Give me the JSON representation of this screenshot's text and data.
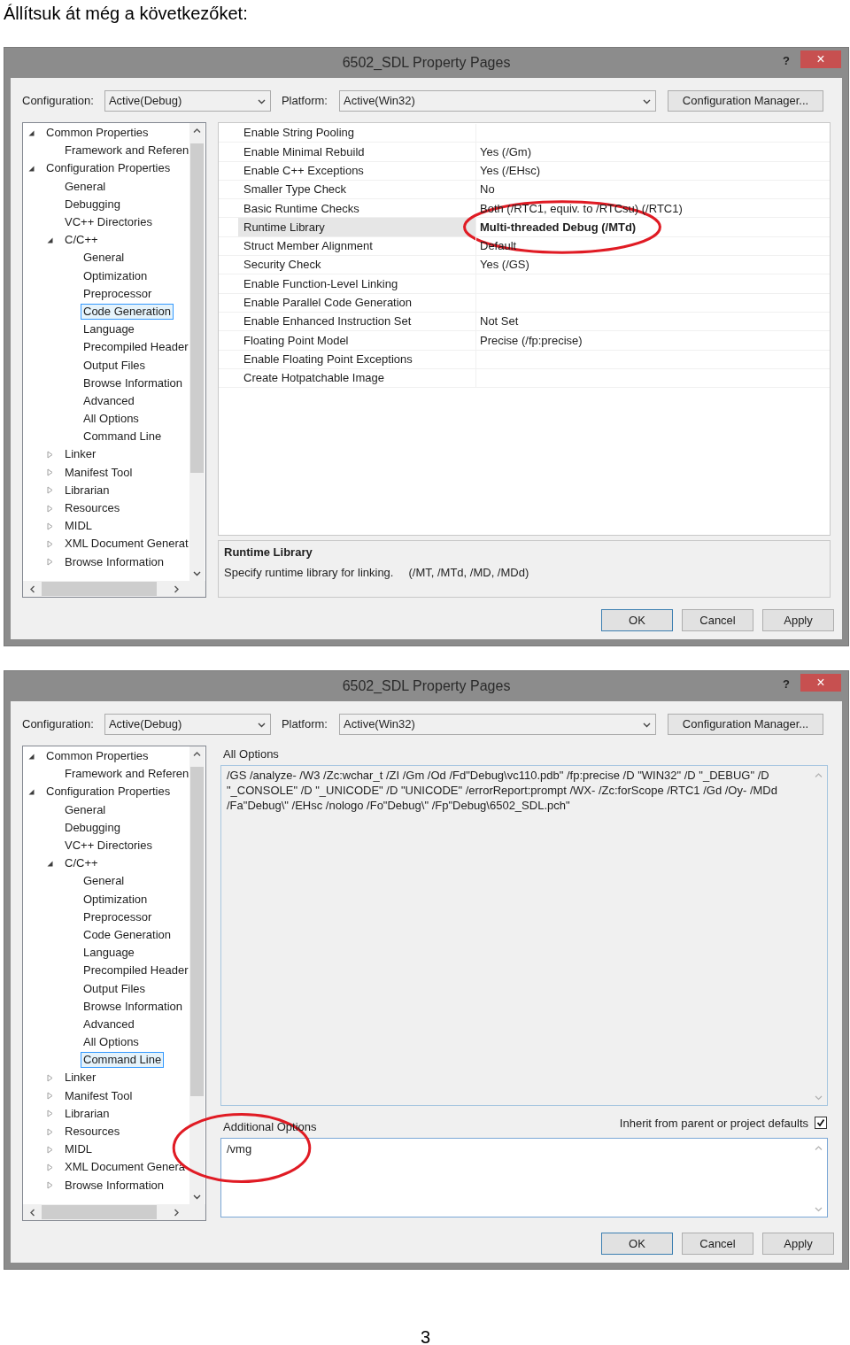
{
  "heading": "Állítsuk át még a következőket:",
  "dialogs": [
    {
      "title": "6502_SDL Property Pages",
      "help": "?",
      "close": "×",
      "configuration": {
        "label": "Configuration:",
        "value": "Active(Debug)"
      },
      "platform": {
        "label": "Platform:",
        "value": "Active(Win32)"
      },
      "manager_button": "Configuration Manager...",
      "tree": [
        {
          "label": "Common Properties",
          "expanded": true,
          "selected": false,
          "children": [
            {
              "label": "Framework and Referen",
              "selected": false
            }
          ]
        },
        {
          "label": "Configuration Properties",
          "expanded": true,
          "selected": false,
          "children": [
            {
              "label": "General",
              "selected": false
            },
            {
              "label": "Debugging",
              "selected": false
            },
            {
              "label": "VC++ Directories",
              "selected": false
            },
            {
              "label": "C/C++",
              "expanded": true,
              "selected": false,
              "children": [
                {
                  "label": "General",
                  "selected": false
                },
                {
                  "label": "Optimization",
                  "selected": false
                },
                {
                  "label": "Preprocessor",
                  "selected": false
                },
                {
                  "label": "Code Generation",
                  "selected": true
                },
                {
                  "label": "Language",
                  "selected": false
                },
                {
                  "label": "Precompiled Header",
                  "selected": false
                },
                {
                  "label": "Output Files",
                  "selected": false
                },
                {
                  "label": "Browse Information",
                  "selected": false
                },
                {
                  "label": "Advanced",
                  "selected": false
                },
                {
                  "label": "All Options",
                  "selected": false
                },
                {
                  "label": "Command Line",
                  "selected": false
                }
              ]
            },
            {
              "label": "Linker",
              "expanded": false,
              "selected": false
            },
            {
              "label": "Manifest Tool",
              "expanded": false,
              "selected": false
            },
            {
              "label": "Librarian",
              "expanded": false,
              "selected": false
            },
            {
              "label": "Resources",
              "expanded": false,
              "selected": false
            },
            {
              "label": "MIDL",
              "expanded": false,
              "selected": false
            },
            {
              "label": "XML Document Generat",
              "expanded": false,
              "selected": false
            },
            {
              "label": "Browse Information",
              "expanded": false,
              "selected": false
            }
          ]
        }
      ],
      "content": {
        "kind": "grid",
        "rows": [
          {
            "name": "Enable String Pooling",
            "selected": false
          },
          {
            "name": "Enable Minimal Rebuild",
            "value": "Yes (/Gm)",
            "selected": false,
            "bold": false
          },
          {
            "name": "Enable C++ Exceptions",
            "value": "Yes (/EHsc)",
            "selected": false,
            "bold": false
          },
          {
            "name": "Smaller Type Check",
            "value": "No",
            "selected": false,
            "bold": false
          },
          {
            "name": "Basic Runtime Checks",
            "value": "Both (/RTC1, equiv. to /RTCsu) (/RTC1)",
            "selected": false,
            "bold": false
          },
          {
            "name": "Runtime Library",
            "value": "Multi-threaded Debug (/MTd)",
            "selected": true,
            "bold": true,
            "circled": true
          },
          {
            "name": "Struct Member Alignment",
            "value": "Default",
            "selected": false,
            "bold": false
          },
          {
            "name": "Security Check",
            "value": "Yes (/GS)",
            "selected": false,
            "bold": false
          },
          {
            "name": "Enable Function-Level Linking",
            "selected": false
          },
          {
            "name": "Enable Parallel Code Generation",
            "selected": false
          },
          {
            "name": "Enable Enhanced Instruction Set",
            "value": "Not Set",
            "selected": false,
            "bold": false
          },
          {
            "name": "Floating Point Model",
            "value": "Precise (/fp:precise)",
            "selected": false,
            "bold": false
          },
          {
            "name": "Enable Floating Point Exceptions",
            "selected": false
          },
          {
            "name": "Create Hotpatchable Image",
            "selected": false
          }
        ],
        "description": {
          "title": "Runtime Library",
          "text": "Specify runtime library for linking.",
          "options": "(/MT, /MTd, /MD, /MDd)"
        }
      },
      "buttons": [
        {
          "label": "OK",
          "default": true
        },
        {
          "label": "Cancel",
          "default": false
        },
        {
          "label": "Apply",
          "default": false
        }
      ]
    },
    {
      "title": "6502_SDL Property Pages",
      "help": "?",
      "close": "×",
      "configuration": {
        "label": "Configuration:",
        "value": "Active(Debug)"
      },
      "platform": {
        "label": "Platform:",
        "value": "Active(Win32)"
      },
      "manager_button": "Configuration Manager...",
      "tree": [
        {
          "label": "Common Properties",
          "expanded": true,
          "selected": false,
          "children": [
            {
              "label": "Framework and Referen",
              "selected": false
            }
          ]
        },
        {
          "label": "Configuration Properties",
          "expanded": true,
          "selected": false,
          "children": [
            {
              "label": "General",
              "selected": false
            },
            {
              "label": "Debugging",
              "selected": false
            },
            {
              "label": "VC++ Directories",
              "selected": false
            },
            {
              "label": "C/C++",
              "expanded": true,
              "selected": false,
              "children": [
                {
                  "label": "General",
                  "selected": false
                },
                {
                  "label": "Optimization",
                  "selected": false
                },
                {
                  "label": "Preprocessor",
                  "selected": false
                },
                {
                  "label": "Code Generation",
                  "selected": false
                },
                {
                  "label": "Language",
                  "selected": false
                },
                {
                  "label": "Precompiled Header",
                  "selected": false
                },
                {
                  "label": "Output Files",
                  "selected": false
                },
                {
                  "label": "Browse Information",
                  "selected": false
                },
                {
                  "label": "Advanced",
                  "selected": false
                },
                {
                  "label": "All Options",
                  "selected": false
                },
                {
                  "label": "Command Line",
                  "selected": true
                }
              ]
            },
            {
              "label": "Linker",
              "expanded": false,
              "selected": false
            },
            {
              "label": "Manifest Tool",
              "expanded": false,
              "selected": false
            },
            {
              "label": "Librarian",
              "expanded": false,
              "selected": false
            },
            {
              "label": "Resources",
              "expanded": false,
              "selected": false
            },
            {
              "label": "MIDL",
              "expanded": false,
              "selected": false
            },
            {
              "label": "XML Document Genera",
              "expanded": false,
              "selected": false
            },
            {
              "label": "Browse Information",
              "expanded": false,
              "selected": false
            }
          ]
        }
      ],
      "content": {
        "kind": "options",
        "all_label": "All Options",
        "all_text": "/GS /analyze- /W3 /Zc:wchar_t /ZI /Gm /Od /Fd\"Debug\\vc110.pdb\" /fp:precise /D \"WIN32\" /D \"_DEBUG\" /D \"_CONSOLE\" /D \"_UNICODE\" /D \"UNICODE\" /errorReport:prompt /WX- /Zc:forScope /RTC1 /Gd /Oy- /MDd /Fa\"Debug\\\" /EHsc /nologo /Fo\"Debug\\\" /Fp\"Debug\\6502_SDL.pch\"",
        "additional_label": "Additional Options",
        "additional_value": "/vmg",
        "inherit": {
          "label": "Inherit from parent or project defaults",
          "checked": true
        },
        "circled": true
      },
      "buttons": [
        {
          "label": "OK",
          "default": true
        },
        {
          "label": "Cancel",
          "default": false
        },
        {
          "label": "Apply",
          "default": false
        }
      ]
    }
  ],
  "page_number": "3"
}
